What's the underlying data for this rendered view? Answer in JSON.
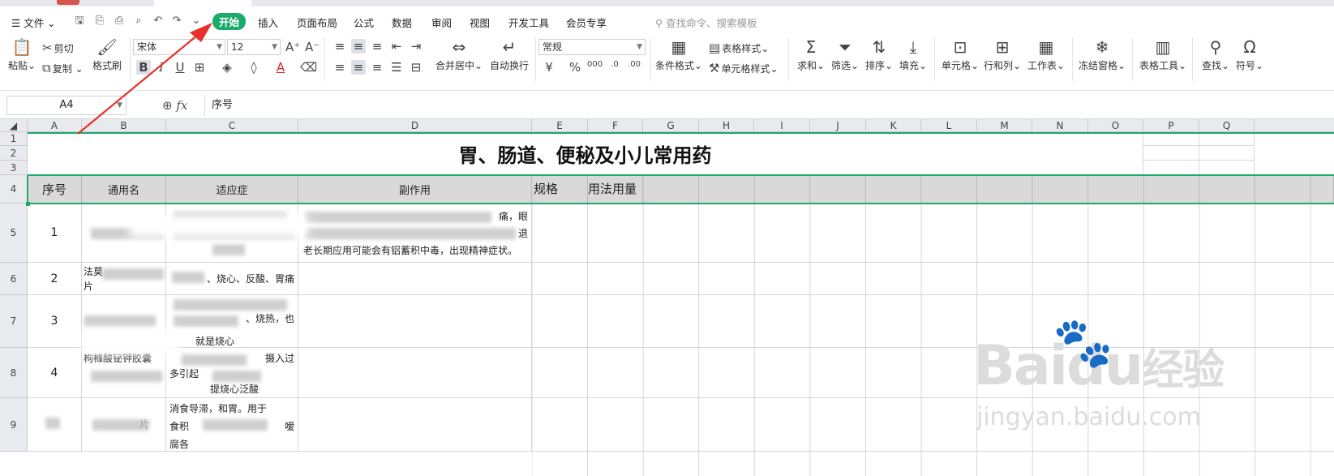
{
  "menubar": {
    "file_label": "文件",
    "tabs": [
      {
        "label": "开始",
        "active": true
      },
      {
        "label": "插入"
      },
      {
        "label": "页面布局"
      },
      {
        "label": "公式"
      },
      {
        "label": "数据"
      },
      {
        "label": "审阅"
      },
      {
        "label": "视图"
      },
      {
        "label": "开发工具"
      },
      {
        "label": "会员专享"
      }
    ],
    "search_placeholder": "查找命令、搜索模板"
  },
  "ribbon": {
    "paste": "粘贴",
    "cut": "剪切",
    "copy": "复制",
    "format_painter": "格式刷",
    "font_name": "宋体",
    "font_size": "12",
    "merge_center": "合并居中",
    "wrap_text": "自动换行",
    "number_format": "常规",
    "conditional_format": "条件格式",
    "table_style": "表格样式",
    "cell_style": "单元格样式",
    "sum": "求和",
    "filter": "筛选",
    "sort": "排序",
    "fill": "填充",
    "cell": "单元格",
    "row_col": "行和列",
    "worksheet": "工作表",
    "freeze": "冻结窗格",
    "table_tools": "表格工具",
    "find": "查找",
    "symbol": "符号"
  },
  "formula_bar": {
    "name_box": "A4",
    "formula": "序号"
  },
  "sheet": {
    "columns": [
      "A",
      "B",
      "C",
      "D",
      "E",
      "F",
      "G",
      "H",
      "I",
      "J",
      "K",
      "L",
      "M",
      "N",
      "O",
      "P",
      "Q"
    ],
    "rows": [
      "1",
      "2",
      "3",
      "4",
      "5",
      "6",
      "7",
      "8",
      "9"
    ],
    "title": "胃、肠道、便秘及小儿常用药",
    "headers": [
      "序号",
      "通用名",
      "适应症",
      "副作用",
      "规格",
      "用法用量"
    ],
    "serials": [
      "1",
      "2",
      "3",
      "4",
      ""
    ],
    "visible_text": {
      "r5_d_tail1": "痛，眼",
      "r5_d_tail2": "退",
      "r5_d_line3": "老长期应用可能会有铝蓄积中毒，出现精神症状。",
      "r6_b": "法莫",
      "r6_b2": "片",
      "r6_c": "、烧心、反酸、胃痛",
      "r7_c": "、烧热，也",
      "r8_c_top": "就是烧心",
      "r8_b": "枸橼酸铋钾胶囊",
      "r8_c_mid": "摄入过",
      "r8_c_3": "多引起",
      "r8_c_4": "提烧心泛酸",
      "r9_c_1": "消食导滞，和胃。用于",
      "r9_c_2": "食积",
      "r9_c_2b": "嗳",
      "r9_c_3": "腐各",
      "r9_b": "片"
    }
  },
  "watermark": {
    "brand": "Baidu",
    "brand_cn": "经验",
    "url": "jingyan.baidu.com"
  },
  "colors": {
    "accent": "#1aaa6b",
    "header_fill": "#d9d9d9",
    "arrow": "#e8302a"
  }
}
